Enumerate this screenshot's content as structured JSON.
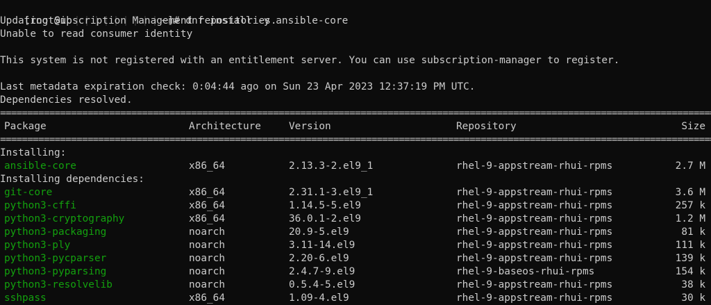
{
  "prompt": {
    "user": "[root@ip",
    "path": "~]#",
    "command": "dnf install -y ansible-core"
  },
  "messages": [
    "Updating Subscription Management repositories.",
    "Unable to read consumer identity",
    "This system is not registered with an entitlement server. You can use subscription-manager to register.",
    "Last metadata expiration check: 0:04:44 ago on Sun 23 Apr 2023 12:37:19 PM UTC.",
    "Dependencies resolved."
  ],
  "separator": "================================================================================================================================================",
  "table": {
    "headers": [
      "Package",
      "Architecture",
      "Version",
      "Repository",
      "Size"
    ],
    "section_installing": "Installing:",
    "section_dependencies": "Installing dependencies:",
    "installing": [
      {
        "name": "ansible-core",
        "arch": "x86_64",
        "version": "2.13.3-2.el9_1",
        "repo": "rhel-9-appstream-rhui-rpms",
        "size": "2.7 M"
      }
    ],
    "dependencies": [
      {
        "name": "git-core",
        "arch": "x86_64",
        "version": "2.31.1-3.el9_1",
        "repo": "rhel-9-appstream-rhui-rpms",
        "size": "3.6 M"
      },
      {
        "name": "python3-cffi",
        "arch": "x86_64",
        "version": "1.14.5-5.el9",
        "repo": "rhel-9-appstream-rhui-rpms",
        "size": "257 k"
      },
      {
        "name": "python3-cryptography",
        "arch": "x86_64",
        "version": "36.0.1-2.el9",
        "repo": "rhel-9-appstream-rhui-rpms",
        "size": "1.2 M"
      },
      {
        "name": "python3-packaging",
        "arch": "noarch",
        "version": "20.9-5.el9",
        "repo": "rhel-9-appstream-rhui-rpms",
        "size": "81 k"
      },
      {
        "name": "python3-ply",
        "arch": "noarch",
        "version": "3.11-14.el9",
        "repo": "rhel-9-appstream-rhui-rpms",
        "size": "111 k"
      },
      {
        "name": "python3-pycparser",
        "arch": "noarch",
        "version": "2.20-6.el9",
        "repo": "rhel-9-appstream-rhui-rpms",
        "size": "139 k"
      },
      {
        "name": "python3-pyparsing",
        "arch": "noarch",
        "version": "2.4.7-9.el9",
        "repo": "rhel-9-baseos-rhui-rpms",
        "size": "154 k"
      },
      {
        "name": "python3-resolvelib",
        "arch": "noarch",
        "version": "0.5.4-5.el9",
        "repo": "rhel-9-appstream-rhui-rpms",
        "size": "38 k"
      },
      {
        "name": "sshpass",
        "arch": "x86_64",
        "version": "1.09-4.el9",
        "repo": "rhel-9-appstream-rhui-rpms",
        "size": "30 k"
      }
    ]
  },
  "colors": {
    "background": "#0c0c0c",
    "text": "#cccccc",
    "package_name": "#13a10e"
  }
}
